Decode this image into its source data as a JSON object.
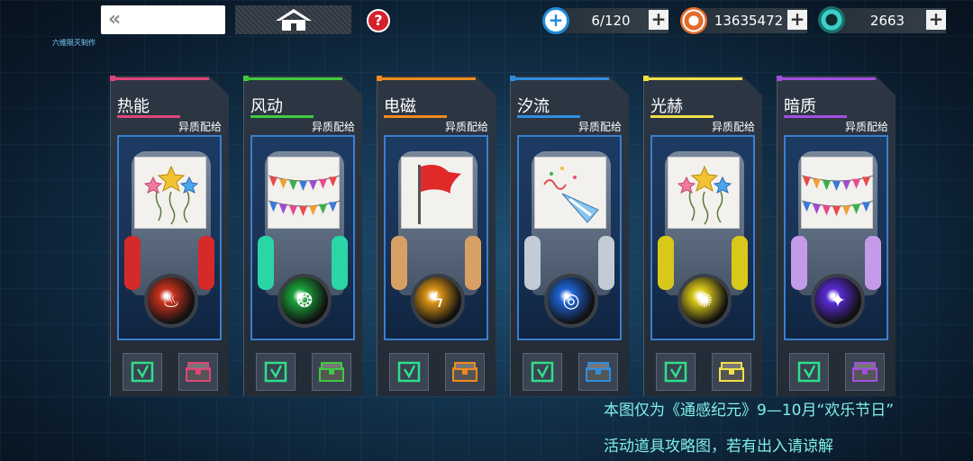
{
  "topbar": {
    "back_label": "«",
    "help_label": "?",
    "credit": "六维陨灭制作"
  },
  "resources": [
    {
      "icon": "plus-circle-icon",
      "value": "6/120",
      "color": "#1e8ad8"
    },
    {
      "icon": "coin-icon",
      "value": "13635472",
      "color": "#e26a2c"
    },
    {
      "icon": "crystal-gear-icon",
      "value": "2663",
      "color": "#3bd0c8"
    }
  ],
  "plus_label": "+",
  "cards": [
    {
      "title": "热能",
      "subtitle": "异质配给",
      "accent": "#e0457a",
      "orb_color": "#c7321e",
      "orb_glyph": "♨",
      "item": "balloons",
      "arm_color": "#d42a2a"
    },
    {
      "title": "风动",
      "subtitle": "异质配给",
      "accent": "#3fca3f",
      "orb_color": "#1aa23a",
      "orb_glyph": "❂",
      "item": "bunting",
      "arm_color": "#2ad6a6"
    },
    {
      "title": "电磁",
      "subtitle": "异质配给",
      "accent": "#f08a1e",
      "orb_color": "#d99216",
      "orb_glyph": "ϟ",
      "item": "flag",
      "arm_color": "#d9a066"
    },
    {
      "title": "汐流",
      "subtitle": "异质配给",
      "accent": "#2f8ee0",
      "orb_color": "#1e63d4",
      "orb_glyph": "◎",
      "item": "party-horn",
      "arm_color": "#c2cbd6"
    },
    {
      "title": "光赫",
      "subtitle": "异质配给",
      "accent": "#f0e04a",
      "orb_color": "#d8c81a",
      "orb_glyph": "✺",
      "item": "balloons",
      "arm_color": "#d8c81a"
    },
    {
      "title": "暗质",
      "subtitle": "异质配给",
      "accent": "#a24fe0",
      "orb_color": "#5a2ad4",
      "orb_glyph": "✦",
      "item": "bunting",
      "arm_color": "#c49be8"
    }
  ],
  "caption": {
    "line1": "本图仅为《通感纪元》9—10月“欢乐节日”",
    "line2": "活动道具攻略图，若有出入请谅解"
  }
}
